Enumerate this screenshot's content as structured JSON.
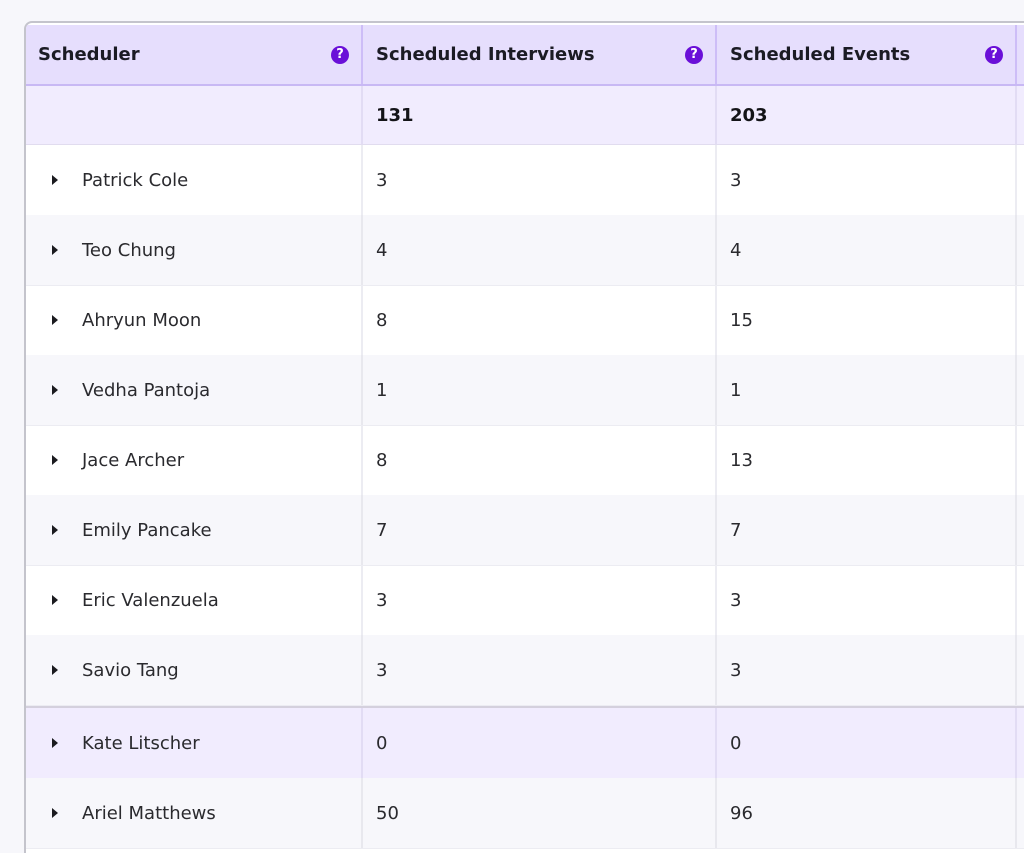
{
  "table": {
    "columns": [
      {
        "label": "Scheduler",
        "help_icon": "question-circle-icon"
      },
      {
        "label": "Scheduled Interviews",
        "help_icon": "question-circle-icon"
      },
      {
        "label": "Scheduled Events",
        "help_icon": "question-circle-icon"
      }
    ],
    "totals": {
      "scheduler": "",
      "interviews": "131",
      "events": "203"
    },
    "rows": [
      {
        "name": "Patrick Cole",
        "interviews": "3",
        "events": "3"
      },
      {
        "name": "Teo Chung",
        "interviews": "4",
        "events": "4"
      },
      {
        "name": "Ahryun Moon",
        "interviews": "8",
        "events": "15"
      },
      {
        "name": "Vedha Pantoja",
        "interviews": "1",
        "events": "1"
      },
      {
        "name": "Jace Archer",
        "interviews": "8",
        "events": "13"
      },
      {
        "name": "Emily Pancake",
        "interviews": "7",
        "events": "7"
      },
      {
        "name": "Eric Valenzuela",
        "interviews": "3",
        "events": "3"
      },
      {
        "name": "Savio Tang",
        "interviews": "3",
        "events": "3"
      },
      {
        "name": "Kate Litscher",
        "interviews": "0",
        "events": "0"
      },
      {
        "name": "Ariel Matthews",
        "interviews": "50",
        "events": "96"
      }
    ],
    "highlighted_row": "Kate Litscher",
    "help_glyph": "?"
  },
  "colors": {
    "accent": "#6a0fd8",
    "header_bg": "#e6defd",
    "highlight_bg": "#f1ecfe"
  }
}
